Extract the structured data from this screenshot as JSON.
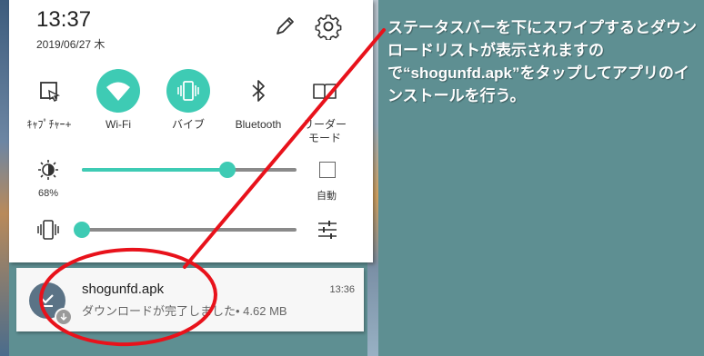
{
  "status": {
    "time": "13:37",
    "date": "2019/06/27 木"
  },
  "quick_settings": [
    {
      "label": "ｷｬﾌﾟﾁｬｰ+",
      "icon": "screen-capture-icon",
      "active": false
    },
    {
      "label": "Wi-Fi",
      "icon": "wifi-icon",
      "active": true
    },
    {
      "label": "バイブ",
      "icon": "vibrate-icon",
      "active": true
    },
    {
      "label": "Bluetooth",
      "icon": "bluetooth-icon",
      "active": false
    },
    {
      "label": "リーダー\nモード",
      "icon": "reader-mode-icon",
      "active": false
    }
  ],
  "brightness": {
    "label": "68%",
    "level": 0.68,
    "auto_label": "自動"
  },
  "volume": {
    "level": 0.0
  },
  "notification": {
    "title": "shogunfd.apk",
    "text": "ダウンロードが完了しました• 4.62 MB",
    "time": "13:36"
  },
  "caption": "ステータスバーを下にスワイプするとダウンロードリストが表示されますので“shogunfd.apk”をタップしてアプリのインストールを行う。",
  "colors": {
    "accent": "#3ecbb4",
    "annotation": "#e8121b",
    "background": "#5e8f92"
  }
}
